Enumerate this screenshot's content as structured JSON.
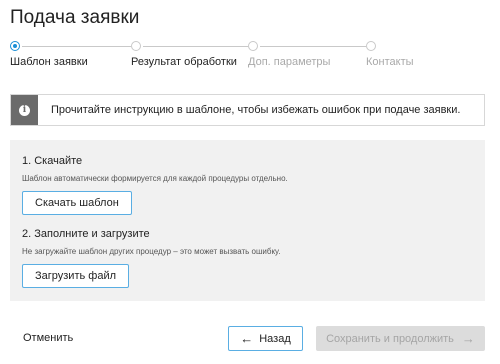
{
  "page": {
    "title": "Подача заявки"
  },
  "stepper": {
    "steps": [
      {
        "label": "Шаблон заявки",
        "state": "active"
      },
      {
        "label": "Результат обработки",
        "state": "pending"
      },
      {
        "label": "Доп. параметры",
        "state": "disabled"
      },
      {
        "label": "Контакты",
        "state": "disabled"
      }
    ]
  },
  "notice": {
    "icon": "info-icon",
    "text": "Прочитайте инструкцию в шаблоне, чтобы избежать ошибок при подаче заявки."
  },
  "download_section": {
    "title": "1. Скачайте",
    "hint": "Шаблон автоматически формируется для каждой процедуры отдельно.",
    "button_label": "Скачать шаблон"
  },
  "upload_section": {
    "title": "2. Заполните и загрузите",
    "hint": "Не загружайте шаблон других процедур – это может вызвать ошибку.",
    "button_label": "Загрузить файл"
  },
  "footer": {
    "cancel_label": "Отменить",
    "back_label": "Назад",
    "back_icon": "arrow-left-icon",
    "next_label": "Сохранить и продолжить",
    "next_icon": "arrow-right-icon"
  },
  "colors": {
    "accent": "#1b8fd6",
    "button_border": "#5aaee3",
    "panel_bg": "#f1f1f1",
    "notice_icon_bg": "#6b6b6b",
    "disabled_text": "#a9a9a9"
  }
}
